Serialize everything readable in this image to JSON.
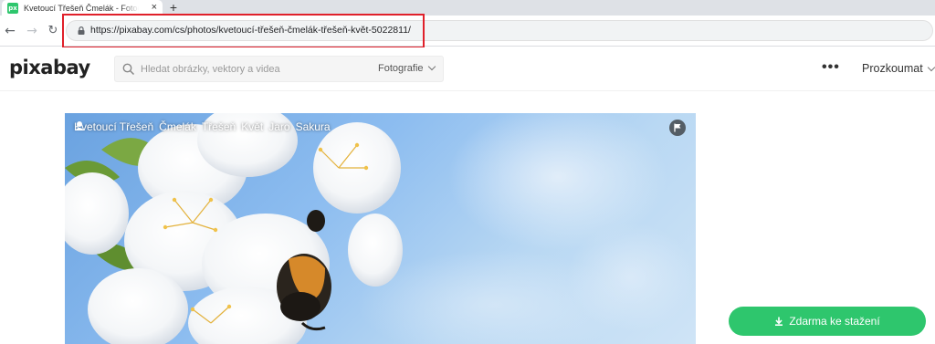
{
  "browser": {
    "tab_title": "Kvetoucí Třešeň Čmelák - Fotografie zdarma na Pixabay",
    "favicon_text": "px",
    "tab_close": "×",
    "new_tab": "+",
    "url_host": "https://pixabay.com",
    "url_path": "/cs/photos/kvetoucí-třešeň-čmelák-třešeň-květ-5022811/",
    "highlight_color": "#e0202a"
  },
  "header": {
    "logo": "pixabay",
    "search_placeholder": "Hledat obrázky, vektory a videa",
    "search_type": "Fotografie",
    "more": "•••",
    "explore": "Prozkoumat"
  },
  "photo": {
    "tags": [
      "Kvetoucí Třešeň",
      "Čmelák",
      "Třešeň",
      "Květ",
      "Jaro",
      "Sakura"
    ]
  },
  "actions": {
    "download_label": "Zdarma ke stažení",
    "accent": "#2ec66d"
  }
}
